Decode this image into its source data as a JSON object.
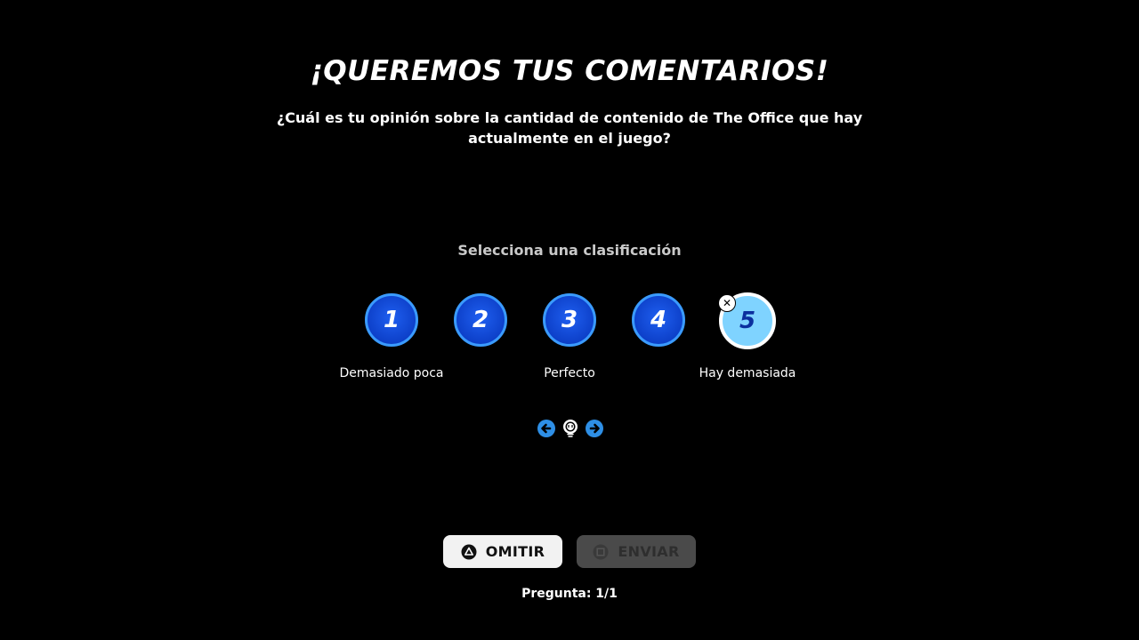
{
  "header": {
    "title": "¡QUEREMOS TUS COMENTARIOS!",
    "question": "¿Cuál es tu opinión sobre la cantidad de contenido de The Office que hay actualmente en el juego?"
  },
  "rating": {
    "prompt": "Selecciona una clasificación",
    "options": [
      {
        "label": "1"
      },
      {
        "label": "2"
      },
      {
        "label": "3"
      },
      {
        "label": "4"
      },
      {
        "label": "5"
      }
    ],
    "selected": "5",
    "deselect_glyph": "✕",
    "scale_labels": {
      "low": "Demasiado poca",
      "mid": "Perfecto",
      "high": "Hay demasiada"
    }
  },
  "navigation_hint": {
    "icons": [
      "arrow-left-icon",
      "right-stick-icon",
      "arrow-right-icon"
    ]
  },
  "actions": {
    "skip_label": "OMITIR",
    "skip_icon": "triangle-button-icon",
    "send_label": "ENVIAR",
    "send_icon": "square-button-icon"
  },
  "footer": {
    "counter": "Pregunta: 1/1"
  },
  "colors": {
    "background": "#000000",
    "rating_fill": "#0d40c9",
    "rating_border": "#3a9bff",
    "rating_selected_fill": "#7fd3ff",
    "nav_arrow": "#2e8fe6",
    "skip_bg": "#f2f2f2",
    "send_bg_disabled": "#4a4a4a"
  }
}
